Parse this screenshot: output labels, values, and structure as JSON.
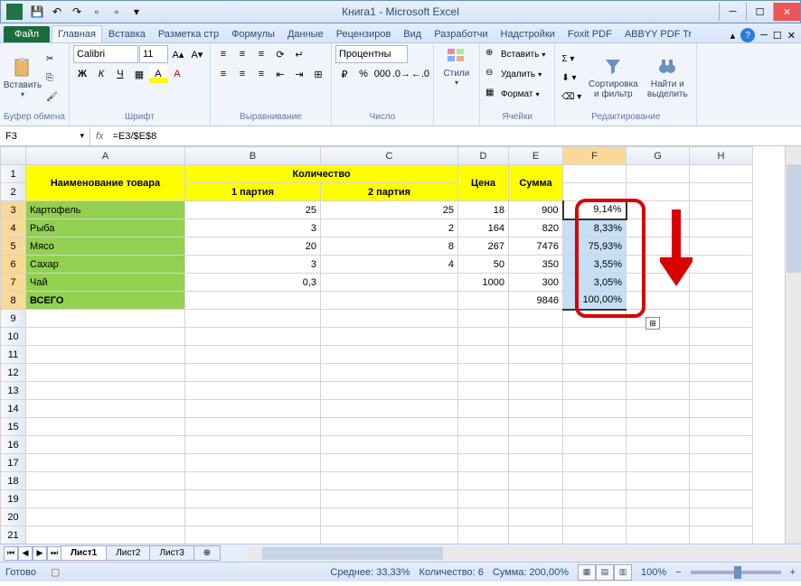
{
  "title": "Книга1 - Microsoft Excel",
  "tabs": {
    "file": "Файл",
    "list": [
      "Главная",
      "Вставка",
      "Разметка стр",
      "Формулы",
      "Данные",
      "Рецензиров",
      "Вид",
      "Разработчи",
      "Надстройки",
      "Foxit PDF",
      "ABBYY PDF Tr"
    ],
    "active": 0
  },
  "ribbon": {
    "clipboard": {
      "paste": "Вставить",
      "label": "Буфер обмена"
    },
    "font": {
      "name": "Calibri",
      "size": "11",
      "label": "Шрифт"
    },
    "alignment": {
      "label": "Выравнивание"
    },
    "number": {
      "format": "Процентны",
      "label": "Число"
    },
    "styles": {
      "label": "Стили",
      "btn": "Стили"
    },
    "cells": {
      "insert": "Вставить",
      "delete": "Удалить",
      "format": "Формат",
      "label": "Ячейки"
    },
    "editing": {
      "sort": "Сортировка и фильтр",
      "find": "Найти и выделить",
      "label": "Редактирование"
    }
  },
  "formula_bar": {
    "cell_ref": "F3",
    "formula": "=E3/$E$8"
  },
  "columns": [
    "A",
    "B",
    "C",
    "D",
    "E",
    "F",
    "G",
    "H"
  ],
  "table": {
    "header_top": {
      "name": "Наименование товара",
      "qty": "Количество",
      "price": "Цена",
      "sum": "Сумма"
    },
    "header_sub": {
      "p1": "1 партия",
      "p2": "2 партия"
    },
    "rows": [
      {
        "name": "Картофель",
        "p1": "25",
        "p2": "25",
        "price": "18",
        "sum": "900",
        "pct": "9,14%"
      },
      {
        "name": "Рыба",
        "p1": "3",
        "p2": "2",
        "price": "164",
        "sum": "820",
        "pct": "8,33%"
      },
      {
        "name": "Мясо",
        "p1": "20",
        "p2": "8",
        "price": "267",
        "sum": "7476",
        "pct": "75,93%"
      },
      {
        "name": "Сахар",
        "p1": "3",
        "p2": "4",
        "price": "50",
        "sum": "350",
        "pct": "3,55%"
      },
      {
        "name": "Чай",
        "p1": "0,3",
        "p2": "",
        "price": "1000",
        "sum": "300",
        "pct": "3,05%"
      }
    ],
    "total": {
      "name": "ВСЕГО",
      "sum": "9846",
      "pct": "100,00%"
    }
  },
  "sheet_tabs": [
    "Лист1",
    "Лист2",
    "Лист3"
  ],
  "status": {
    "ready": "Готово",
    "avg_label": "Среднее:",
    "avg": "33,33%",
    "count_label": "Количество:",
    "count": "6",
    "sum_label": "Сумма:",
    "sum": "200,00%",
    "zoom": "100%"
  }
}
